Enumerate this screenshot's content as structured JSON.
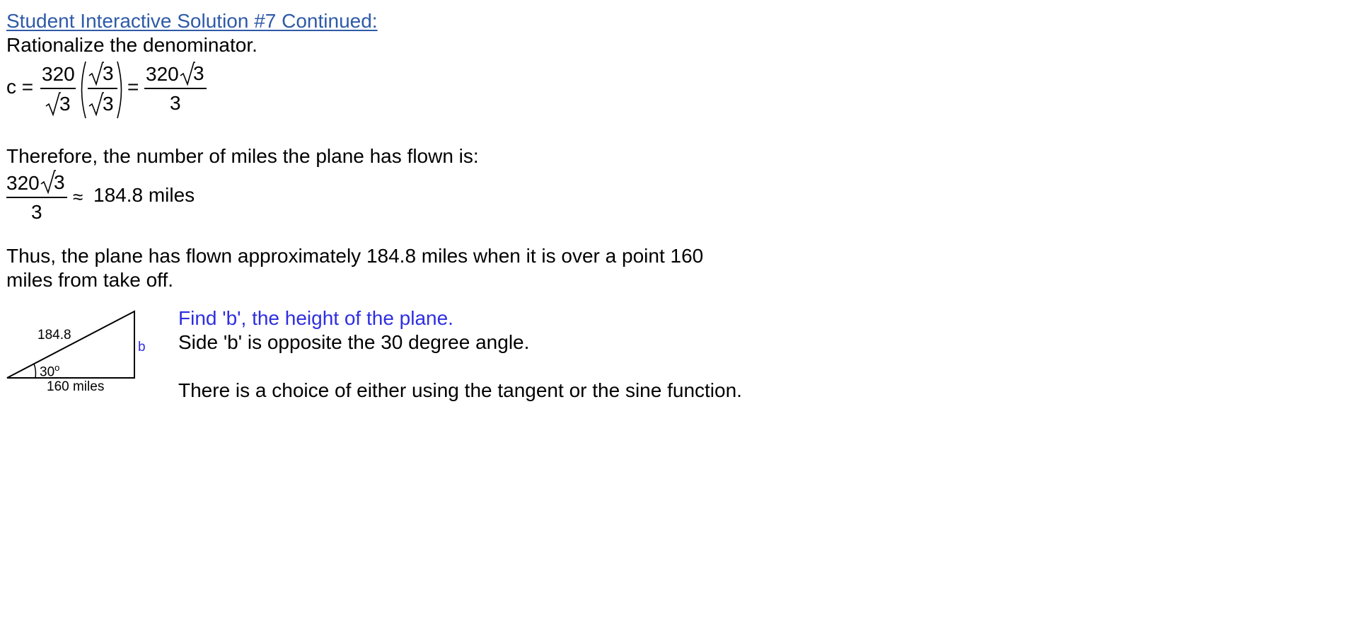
{
  "title": "Student Interactive Solution #7 Continued:",
  "rationalize": "Rationalize the denominator.",
  "eq1": {
    "lhs": "c =",
    "num1": "320",
    "den1_radicand": "3",
    "frac2_num_radicand": "3",
    "frac2_den_radicand": "3",
    "equals": "=",
    "res_num_coef": "320",
    "res_num_radicand": "3",
    "res_den": "3"
  },
  "therefore": "Therefore, the number of miles the plane has flown is:",
  "eq2": {
    "num_coef": "320",
    "num_radicand": "3",
    "den": "3",
    "approx": "≈",
    "value": "184.8 miles"
  },
  "thus": {
    "line1": "Thus, the plane has flown approximately 184.8 miles when it is over a point 160",
    "line2": "miles from take off."
  },
  "triangle": {
    "hyp_label": "184.8",
    "angle_label": "30",
    "angle_degree": "o",
    "base_label": "160 miles",
    "side_label": "b"
  },
  "find_b": "Find 'b', the height of the plane.",
  "side_b": "Side 'b' is opposite the 30 degree angle.",
  "choice": "There is a choice of either using the tangent or the sine function.",
  "colors": {
    "title": "#2e5aa8",
    "highlight": "#2e2ee0",
    "text": "#000000"
  }
}
